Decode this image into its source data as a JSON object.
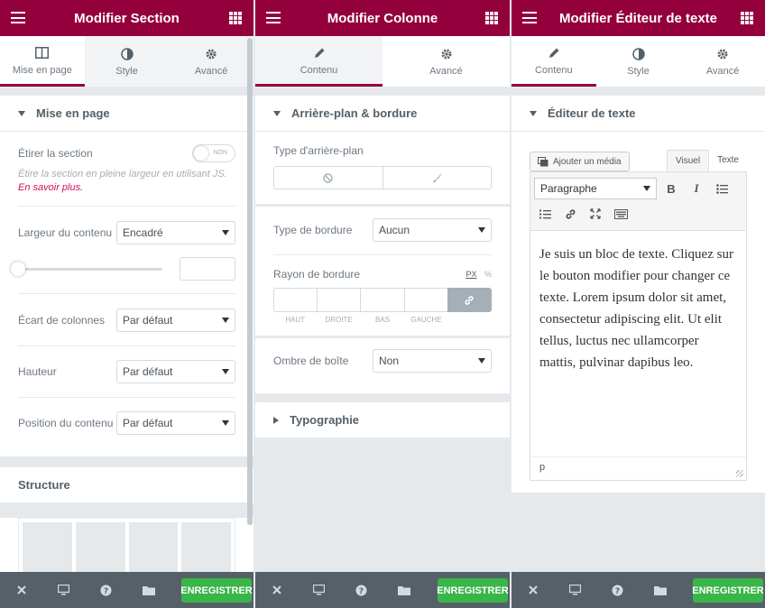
{
  "panel1": {
    "title": "Modifier Section",
    "tabs": [
      "Mise en page",
      "Style",
      "Avancé"
    ],
    "section_title": "Mise en page",
    "stretch_label": "Étirer la section",
    "toggle_text": "NON",
    "hint_text": "Étire la section en pleine largeur en utilisant JS.",
    "hint_link": "En savoir plus.",
    "width_label": "Largeur du contenu",
    "width_value": "Encadré",
    "gap_label": "Écart de colonnes",
    "gap_value": "Par défaut",
    "height_label": "Hauteur",
    "height_value": "Par défaut",
    "position_label": "Position du contenu",
    "position_value": "Par défaut",
    "structure_title": "Structure"
  },
  "panel2": {
    "title": "Modifier Colonne",
    "tabs": [
      "Contenu",
      "Avancé"
    ],
    "section_title": "Arrière-plan & bordure",
    "bg_type_label": "Type d'arrière-plan",
    "border_type_label": "Type de bordure",
    "border_type_value": "Aucun",
    "radius_label": "Rayon de bordure",
    "unit_px": "PX",
    "unit_pct": "%",
    "dims": [
      "HAUT",
      "DROITE",
      "BAS",
      "GAUCHE"
    ],
    "shadow_label": "Ombre de boîte",
    "shadow_value": "Non",
    "typography_title": "Typographie"
  },
  "panel3": {
    "title": "Modifier Éditeur de texte",
    "tabs": [
      "Contenu",
      "Style",
      "Avancé"
    ],
    "section_title": "Éditeur de texte",
    "media_button": "Ajouter un média",
    "tab_visual": "Visuel",
    "tab_text": "Texte",
    "format_value": "Paragraphe",
    "content": "Je suis un bloc de texte. Cliquez sur le bouton modifier pour changer ce texte. Lorem ipsum dolor sit amet, consectetur adipiscing elit. Ut elit tellus, luctus nec ullamcorper mattis, pulvinar dapibus leo.",
    "status_path": "p"
  },
  "footer": {
    "save_label": "ENREGISTRER"
  },
  "colors": {
    "brand": "#93003c",
    "save": "#39b54a",
    "footer": "#556068",
    "link": "#d30c5c"
  }
}
